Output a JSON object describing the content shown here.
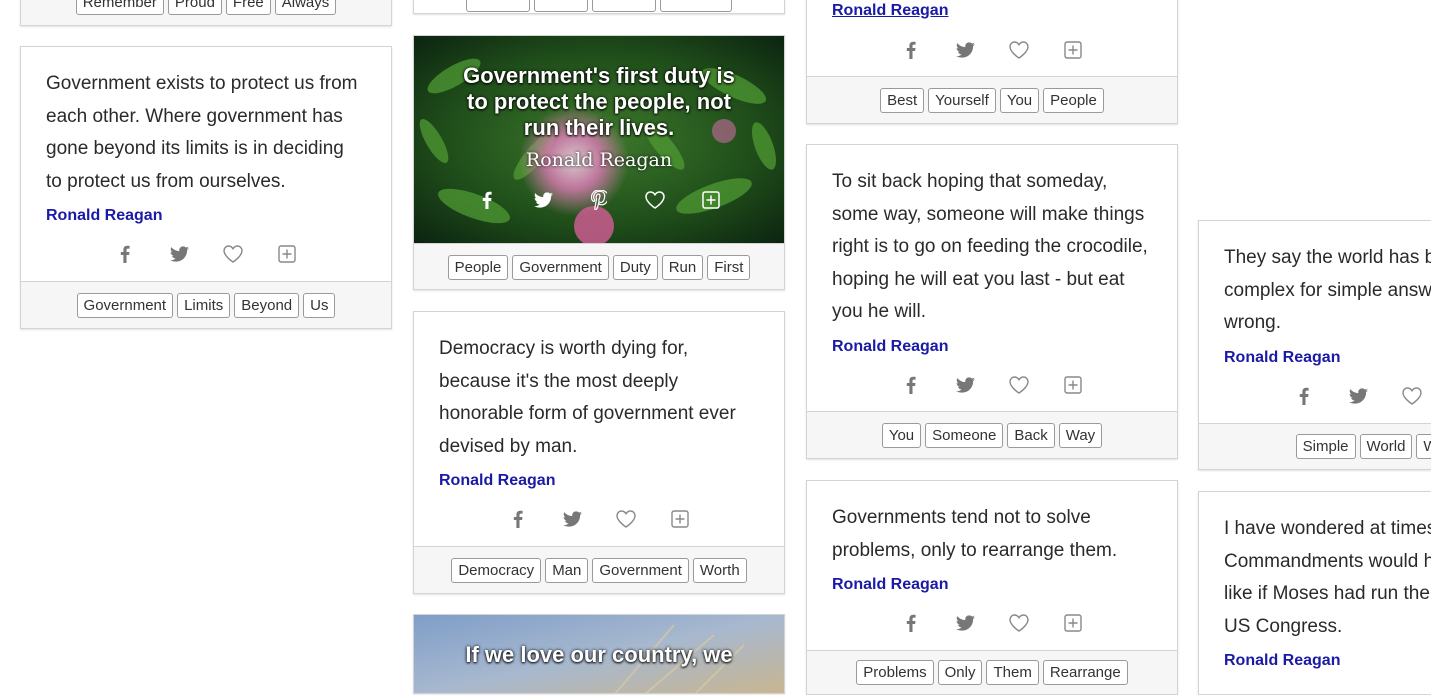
{
  "author": "Ronald Reagan",
  "col1": {
    "top_tags": [
      "Remember",
      "Proud",
      "Free",
      "Always"
    ],
    "card1": {
      "quote": "Government exists to protect us from each other. Where government has gone beyond its limits is in deciding to protect us from ourselves.",
      "tags": [
        "Government",
        "Limits",
        "Beyond",
        "Us"
      ]
    }
  },
  "col2": {
    "image_card": {
      "quote": "Government's first duty is to protect the people, not run their lives.",
      "tags": [
        "People",
        "Government",
        "Duty",
        "Run",
        "First"
      ]
    },
    "card2": {
      "quote": "Democracy is worth dying for, because it's the most deeply honorable form of government ever devised by man.",
      "tags": [
        "Democracy",
        "Man",
        "Government",
        "Worth"
      ]
    },
    "image_card2": {
      "quote": "If we love our country, we"
    }
  },
  "col3": {
    "card_top": {
      "tags": [
        "Best",
        "Yourself",
        "You",
        "People"
      ]
    },
    "card2": {
      "quote": "To sit back hoping that someday, some way, someone will make things right is to go on feeding the crocodile, hoping he will eat you last - but eat you he will.",
      "tags": [
        "You",
        "Someone",
        "Back",
        "Way"
      ]
    },
    "card3": {
      "quote": "Governments tend not to solve problems, only to rearrange them.",
      "tags": [
        "Problems",
        "Only",
        "Them",
        "Rearrange"
      ]
    }
  },
  "col4": {
    "card1": {
      "quote": "They say the world has b complex for simple answ wrong.",
      "tags": [
        "Simple",
        "World",
        "Wrong"
      ]
    },
    "card2": {
      "quote": "I have wondered at times Commandments would h like if Moses had run ther US Congress."
    }
  },
  "icons": [
    "facebook-icon",
    "twitter-icon",
    "pinterest-icon",
    "heart-icon",
    "plus-square-icon"
  ],
  "colors": {
    "author": "#1a1aa6",
    "border": "#d4d4d4",
    "tag_bg": "#f6f6f6"
  }
}
